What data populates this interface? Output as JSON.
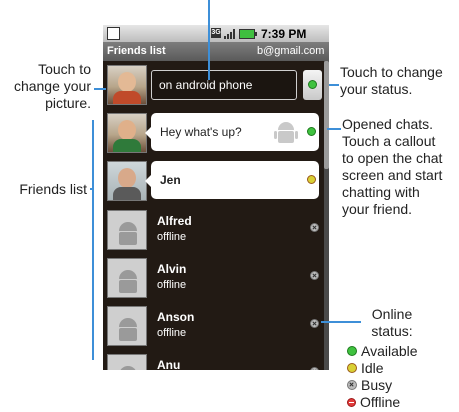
{
  "status_bar": {
    "time": "7:39 PM",
    "left_icon": "notification-icon",
    "right_icons": [
      "network-3g-icon",
      "signal-icon",
      "battery-icon"
    ]
  },
  "title_bar": {
    "title": "Friends list",
    "account": "b@gmail.com"
  },
  "my_status": {
    "placeholder": "on android phone",
    "status": "available"
  },
  "friends": [
    {
      "name": "",
      "message": "Hey what's up?",
      "status": "available",
      "opened_chat": true
    },
    {
      "name": "Jen",
      "message": "",
      "status": "idle",
      "opened_chat": true
    },
    {
      "name": "Alfred",
      "message": "offline",
      "status": "busy",
      "opened_chat": false
    },
    {
      "name": "Alvin",
      "message": "offline",
      "status": "busy",
      "opened_chat": false
    },
    {
      "name": "Anson",
      "message": "offline",
      "status": "busy",
      "opened_chat": false
    },
    {
      "name": "Anu",
      "message": "",
      "status": "busy",
      "opened_chat": false
    }
  ],
  "callouts": {
    "change_picture": "Touch to\nchange your\npicture.",
    "friends_list": "Friends list",
    "change_status": "Touch to change\nyour status.",
    "opened_chats": "Opened chats.\nTouch a callout\nto open the chat\nscreen and start\nchatting with\nyour friend.",
    "online_status": "Online\nstatus:"
  },
  "legend": [
    {
      "label": "Available",
      "status": "available"
    },
    {
      "label": "Idle",
      "status": "idle"
    },
    {
      "label": "Busy",
      "status": "busy"
    },
    {
      "label": "Offline",
      "status": "offline"
    }
  ],
  "colors": {
    "accent_line": "#3d8fd8",
    "available": "#3fc23f",
    "idle": "#d9d034",
    "offline": "#e23b3b"
  }
}
